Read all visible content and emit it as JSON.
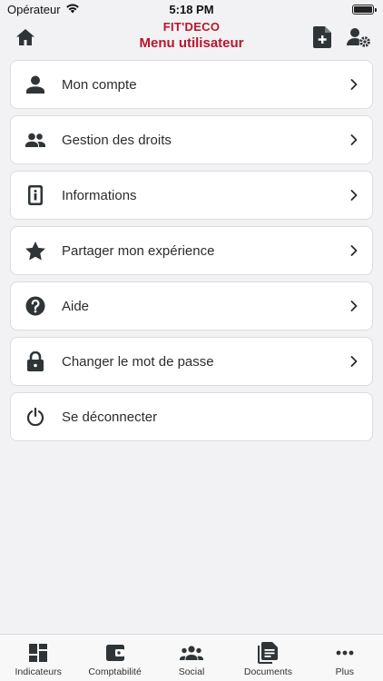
{
  "status_bar": {
    "carrier": "Opérateur",
    "time": "5:18 PM"
  },
  "header": {
    "app_name": "FIT'DECO",
    "title": "Menu utilisateur"
  },
  "menu": {
    "items": [
      {
        "label": "Mon compte",
        "icon": "person-icon",
        "has_chevron": true
      },
      {
        "label": "Gestion des droits",
        "icon": "people-icon",
        "has_chevron": true
      },
      {
        "label": "Informations",
        "icon": "info-icon",
        "has_chevron": true
      },
      {
        "label": "Partager mon expérience",
        "icon": "star-icon",
        "has_chevron": true
      },
      {
        "label": "Aide",
        "icon": "help-icon",
        "has_chevron": true
      },
      {
        "label": "Changer le mot de passe",
        "icon": "lock-icon",
        "has_chevron": true
      },
      {
        "label": "Se déconnecter",
        "icon": "power-icon",
        "has_chevron": false
      }
    ]
  },
  "tabbar": {
    "tabs": [
      {
        "label": "Indicateurs",
        "icon": "dashboard-icon"
      },
      {
        "label": "Comptabilité",
        "icon": "wallet-icon"
      },
      {
        "label": "Social",
        "icon": "group-icon"
      },
      {
        "label": "Documents",
        "icon": "documents-icon"
      },
      {
        "label": "Plus",
        "icon": "more-icon"
      }
    ]
  },
  "colors": {
    "accent": "#b5172e",
    "icon": "#2f3437",
    "background": "#f2f1f3"
  }
}
